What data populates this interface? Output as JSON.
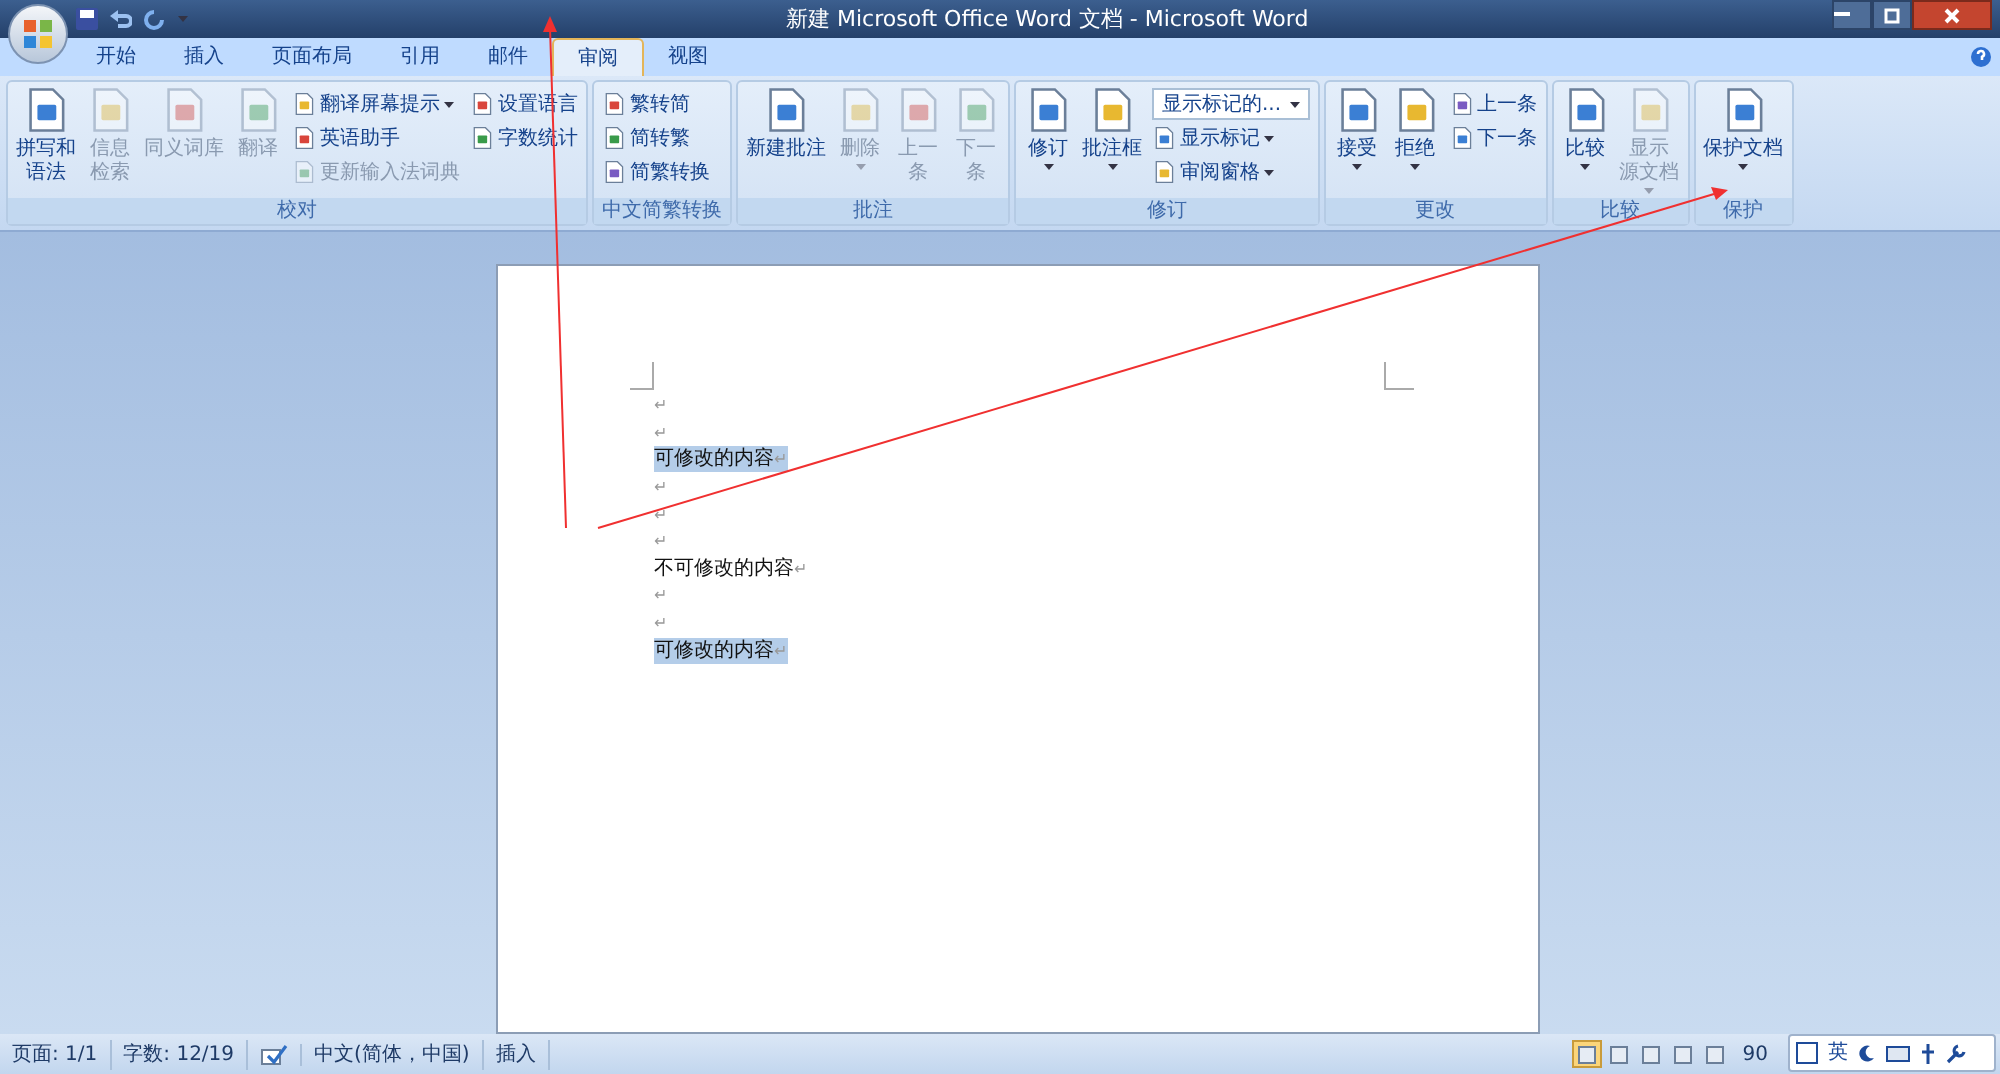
{
  "window": {
    "title": "新建 Microsoft Office Word 文档 - Microsoft Word"
  },
  "tabs": [
    {
      "label": "开始",
      "selected": false
    },
    {
      "label": "插入",
      "selected": false
    },
    {
      "label": "页面布局",
      "selected": false
    },
    {
      "label": "引用",
      "selected": false
    },
    {
      "label": "邮件",
      "selected": false
    },
    {
      "label": "审阅",
      "selected": true
    },
    {
      "label": "视图",
      "selected": false
    }
  ],
  "ribbon_groups": [
    {
      "title": "校对",
      "items": [
        {
          "kind": "large",
          "lines": [
            "拼写和",
            "语法"
          ],
          "disabled": false,
          "dropdown": false
        },
        {
          "kind": "large",
          "lines": [
            "信息",
            "检索"
          ],
          "disabled": true,
          "dropdown": false
        },
        {
          "kind": "large",
          "lines": [
            "同义词库"
          ],
          "disabled": true,
          "dropdown": false
        },
        {
          "kind": "large",
          "lines": [
            "翻译"
          ],
          "disabled": true,
          "dropdown": false
        },
        {
          "kind": "stack",
          "items": [
            {
              "kind": "small",
              "label": "翻译屏幕提示",
              "disabled": false,
              "dropdown": true
            },
            {
              "kind": "small",
              "label": "英语助手",
              "disabled": false,
              "dropdown": false
            },
            {
              "kind": "small",
              "label": "更新输入法词典",
              "disabled": true,
              "dropdown": false
            }
          ]
        },
        {
          "kind": "stack",
          "items": [
            {
              "kind": "small",
              "label": "设置语言",
              "disabled": false,
              "dropdown": false
            },
            {
              "kind": "small",
              "label": "字数统计",
              "disabled": false,
              "dropdown": false
            }
          ]
        }
      ]
    },
    {
      "title": "中文简繁转换",
      "items": [
        {
          "kind": "stack",
          "items": [
            {
              "kind": "small",
              "label": "繁转简",
              "disabled": false,
              "dropdown": false
            },
            {
              "kind": "small",
              "label": "简转繁",
              "disabled": false,
              "dropdown": false
            },
            {
              "kind": "small",
              "label": "简繁转换",
              "disabled": false,
              "dropdown": false
            }
          ]
        }
      ]
    },
    {
      "title": "批注",
      "items": [
        {
          "kind": "large",
          "lines": [
            "新建批注"
          ],
          "disabled": false,
          "dropdown": false
        },
        {
          "kind": "large",
          "lines": [
            "删除"
          ],
          "disabled": true,
          "dropdown": true
        },
        {
          "kind": "large",
          "lines": [
            "上一",
            "条"
          ],
          "disabled": true,
          "dropdown": false
        },
        {
          "kind": "large",
          "lines": [
            "下一",
            "条"
          ],
          "disabled": true,
          "dropdown": false
        }
      ]
    },
    {
      "title": "修订",
      "items": [
        {
          "kind": "large",
          "lines": [
            "修订"
          ],
          "disabled": false,
          "dropdown": true
        },
        {
          "kind": "large",
          "lines": [
            "批注框"
          ],
          "disabled": false,
          "dropdown": true
        },
        {
          "kind": "stack",
          "items": [
            {
              "kind": "combo",
              "label": "显示标记的...",
              "disabled": false,
              "dropdown": true
            },
            {
              "kind": "small",
              "label": "显示标记",
              "disabled": false,
              "dropdown": true
            },
            {
              "kind": "small",
              "label": "审阅窗格",
              "disabled": false,
              "dropdown": true
            }
          ]
        }
      ]
    },
    {
      "title": "更改",
      "items": [
        {
          "kind": "large",
          "lines": [
            "接受"
          ],
          "disabled": false,
          "dropdown": true
        },
        {
          "kind": "large",
          "lines": [
            "拒绝"
          ],
          "disabled": false,
          "dropdown": true
        },
        {
          "kind": "stack",
          "items": [
            {
              "kind": "small",
              "label": "上一条",
              "disabled": false,
              "dropdown": false
            },
            {
              "kind": "small",
              "label": "下一条",
              "disabled": false,
              "dropdown": false
            }
          ]
        }
      ]
    },
    {
      "title": "比较",
      "items": [
        {
          "kind": "large",
          "lines": [
            "比较"
          ],
          "disabled": false,
          "dropdown": true
        },
        {
          "kind": "large",
          "lines": [
            "显示",
            "源文档"
          ],
          "disabled": true,
          "dropdown": true
        }
      ]
    },
    {
      "title": "保护",
      "items": [
        {
          "kind": "large",
          "lines": [
            "保护文档"
          ],
          "disabled": false,
          "dropdown": true
        }
      ]
    }
  ],
  "document": {
    "paragraphs": [
      {
        "mark": "↵",
        "highlighted": false
      },
      {
        "mark": "↵",
        "highlighted": false
      },
      {
        "text": "可修改的内容",
        "mark": "↵",
        "highlighted": true
      },
      {
        "mark": "↵",
        "highlighted": false
      },
      {
        "mark": "↵",
        "highlighted": false
      },
      {
        "mark": "↵",
        "highlighted": false
      },
      {
        "text": "不可修改的内容",
        "mark": "↵",
        "highlighted": false
      },
      {
        "mark": "↵",
        "highlighted": false
      },
      {
        "mark": "↵",
        "highlighted": false
      },
      {
        "text": "可修改的内容",
        "mark": "↵",
        "highlighted": true
      }
    ]
  },
  "status_bar": {
    "items": [
      {
        "kind": "text",
        "label": "页面: 1/1"
      },
      {
        "kind": "text",
        "label": "字数: 12/19"
      },
      {
        "kind": "icon"
      },
      {
        "kind": "text",
        "label": "中文(简体，中国)"
      },
      {
        "kind": "text",
        "label": "插入"
      }
    ],
    "views": [
      {
        "selected": true
      },
      {
        "selected": false
      },
      {
        "selected": false
      },
      {
        "selected": false
      },
      {
        "selected": false
      }
    ],
    "zoom": "90"
  },
  "ime_bar": {
    "label": "英"
  }
}
